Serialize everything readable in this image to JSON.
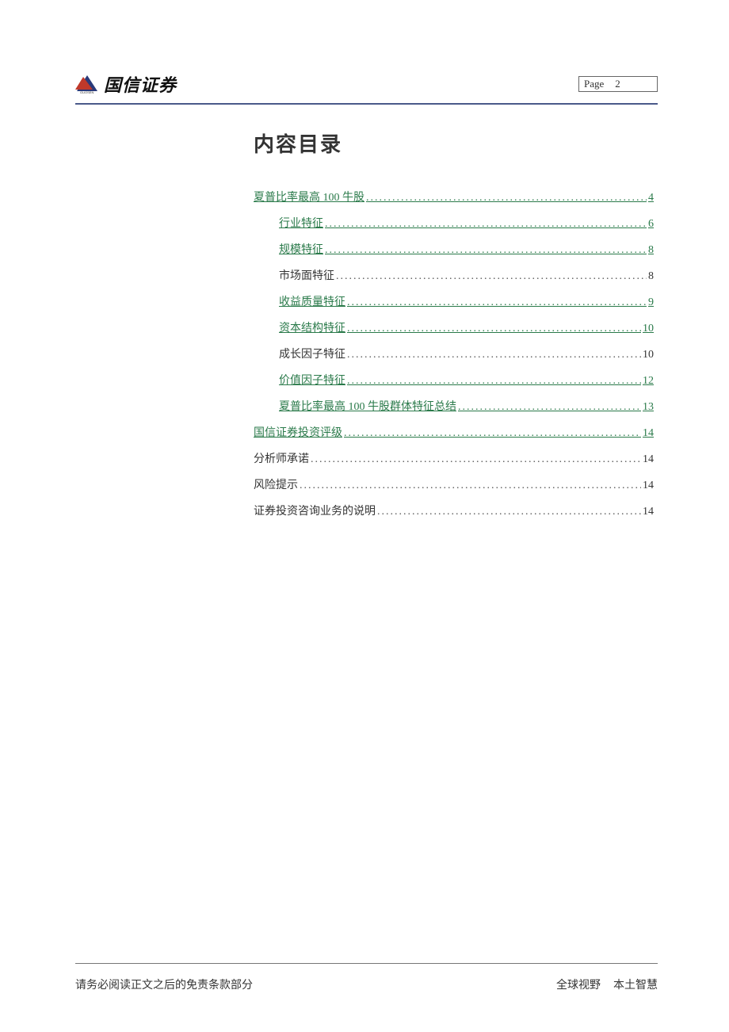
{
  "header": {
    "logo_text": "国信证券",
    "page_label": "Page",
    "page_number": "2"
  },
  "toc": {
    "title": "内容目录",
    "items": [
      {
        "label": "夏普比率最高 100 牛股",
        "page": "4",
        "level": 1,
        "link": true
      },
      {
        "label": "行业特征",
        "page": "6",
        "level": 2,
        "link": true
      },
      {
        "label": "规模特征",
        "page": "8",
        "level": 2,
        "link": true
      },
      {
        "label": "市场面特征",
        "page": "8",
        "level": 2,
        "link": false
      },
      {
        "label": "收益质量特征",
        "page": "9",
        "level": 2,
        "link": true
      },
      {
        "label": "资本结构特征",
        "page": "10",
        "level": 2,
        "link": true
      },
      {
        "label": "成长因子特征",
        "page": "10",
        "level": 2,
        "link": false
      },
      {
        "label": "价值因子特征",
        "page": "12",
        "level": 2,
        "link": true
      },
      {
        "label": "夏普比率最高 100 牛股群体特征总结",
        "page": "13",
        "level": 2,
        "link": true
      },
      {
        "label": "国信证券投资评级",
        "page": "14",
        "level": 1,
        "link": true
      },
      {
        "label": "分析师承诺",
        "page": "14",
        "level": 1,
        "link": false
      },
      {
        "label": "风险提示",
        "page": "14",
        "level": 1,
        "link": false
      },
      {
        "label": "证券投资咨询业务的说明",
        "page": "14",
        "level": 1,
        "link": false
      }
    ]
  },
  "footer": {
    "disclaimer": "请务必阅读正文之后的免责条款部分",
    "tag_left": "全球视野",
    "tag_right": "本土智慧"
  }
}
